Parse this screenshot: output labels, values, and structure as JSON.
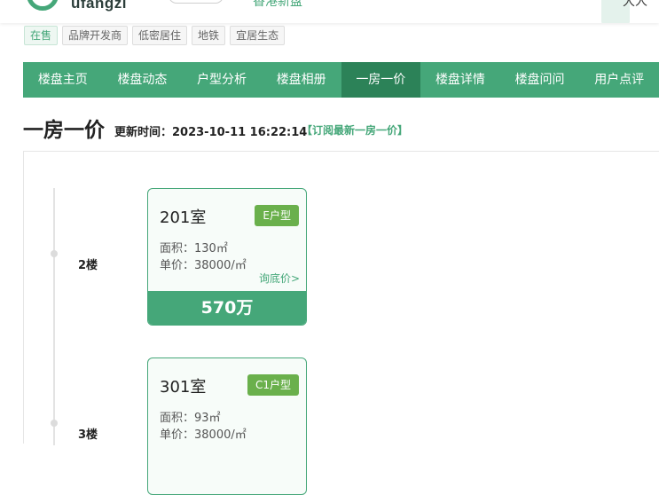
{
  "header": {
    "logo_text": "ufangzi",
    "nav_link": "香港新盘",
    "right_text": "大人"
  },
  "tags": [
    "在售",
    "品牌开发商",
    "低密居住",
    "地铁",
    "宜居生态"
  ],
  "nav": {
    "items": [
      "楼盘主页",
      "楼盘动态",
      "户型分析",
      "楼盘相册",
      "一房一价",
      "楼盘详情",
      "楼盘问问",
      "用户点评"
    ],
    "active_index": 4
  },
  "page": {
    "title": "一房一价",
    "update_label": "更新时间：2023-10-11 16:22:14",
    "subscribe": "【订阅最新一房一价】"
  },
  "floors": [
    {
      "floor": "2楼",
      "room": "201室",
      "type": "E户型",
      "area": "面积：130㎡",
      "unit_price": "单价：38000/㎡",
      "ask": "询底价>",
      "total": "570万"
    },
    {
      "floor": "3楼",
      "room": "301室",
      "type": "C1户型",
      "area": "面积：93㎡",
      "unit_price": "单价：38000/㎡"
    }
  ],
  "colors": {
    "brand": "#45a779",
    "nav_active": "#2c8258",
    "badge": "#6ab04c"
  }
}
